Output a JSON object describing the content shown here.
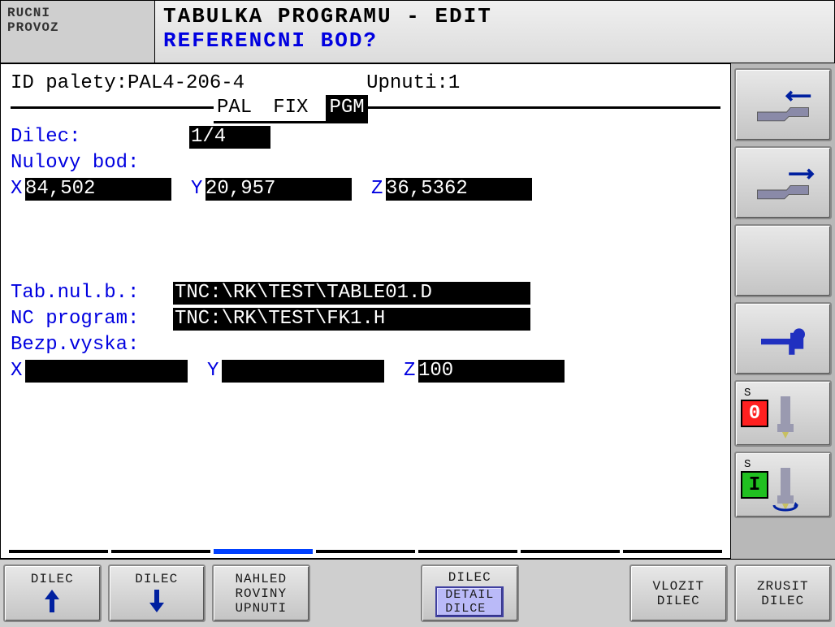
{
  "header": {
    "mode_line1": "RUCNI",
    "mode_line2": "PROVOZ",
    "title": "TABULKA PROGRAMU - EDIT",
    "prompt": "REFERENCNI BOD?"
  },
  "info": {
    "id_label": "ID palety:",
    "id_value": "PAL4-206-4",
    "upnuti_label": "Upnuti:",
    "upnuti_value": "1"
  },
  "tabs": {
    "pal": "PAL",
    "fix": "FIX",
    "pgm": "PGM",
    "selected": "PGM"
  },
  "dilec": {
    "label": "Dilec:",
    "value": "1/4"
  },
  "nulovy": {
    "label": "Nulovy bod:",
    "x_label": "X",
    "x_value": "84,502",
    "y_label": "Y",
    "y_value": "20,957",
    "z_label": "Z",
    "z_value": "36,5362"
  },
  "tabnul": {
    "label": "Tab.nul.b.:",
    "value": "TNC:\\RK\\TEST\\TABLE01.D"
  },
  "ncprog": {
    "label": "NC program:",
    "value": "TNC:\\RK\\TEST\\FK1.H"
  },
  "bezp": {
    "label": "Bezp.vyska:",
    "x_label": "X",
    "x_value": "",
    "y_label": "Y",
    "y_value": "",
    "z_label": "Z",
    "z_value": "100"
  },
  "side": {
    "status1_label": "S",
    "status1_value": "0",
    "status2_label": "S",
    "status2_value": "I"
  },
  "footer": {
    "f1_l1": "DILEC",
    "f2_l1": "DILEC",
    "f3_l1": "NAHLED",
    "f3_l2": "ROVINY",
    "f3_l3": "UPNUTI",
    "f4_l1": "DILEC",
    "f4_btn_l1": "DETAIL",
    "f4_btn_l2": "DILCE",
    "f5_l1": "VLOZIT",
    "f5_l2": "DILEC",
    "f6_l1": "ZRUSIT",
    "f6_l2": "DILEC"
  }
}
